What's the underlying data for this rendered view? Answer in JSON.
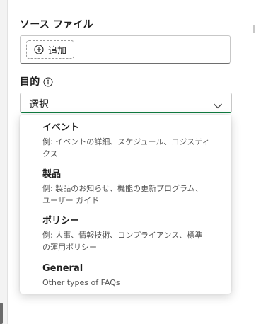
{
  "source_files": {
    "label": "ソース ファイル",
    "add_button_label": "追加"
  },
  "purpose": {
    "label": "目的",
    "select_value": "選択",
    "options": [
      {
        "title": "イベント",
        "description_line1": "例: イベントの詳細、スケジュール、ロジスティ",
        "description_line2": "クス"
      },
      {
        "title": "製品",
        "description_line1": "例: 製品のお知らせ、機能の更新プログラム、",
        "description_line2": "ユーザー ガイド"
      },
      {
        "title": "ポリシー",
        "description_line1": "例: 人事、情報技術、コンプライアンス、標準",
        "description_line2": "の運用ポリシー"
      },
      {
        "title": "General",
        "description_line1": "Other types of FAQs",
        "description_line2": ""
      }
    ]
  },
  "colors": {
    "accent": "#107c41",
    "panel_bg": "#ffffff",
    "page_bg": "#f3f3f3"
  }
}
